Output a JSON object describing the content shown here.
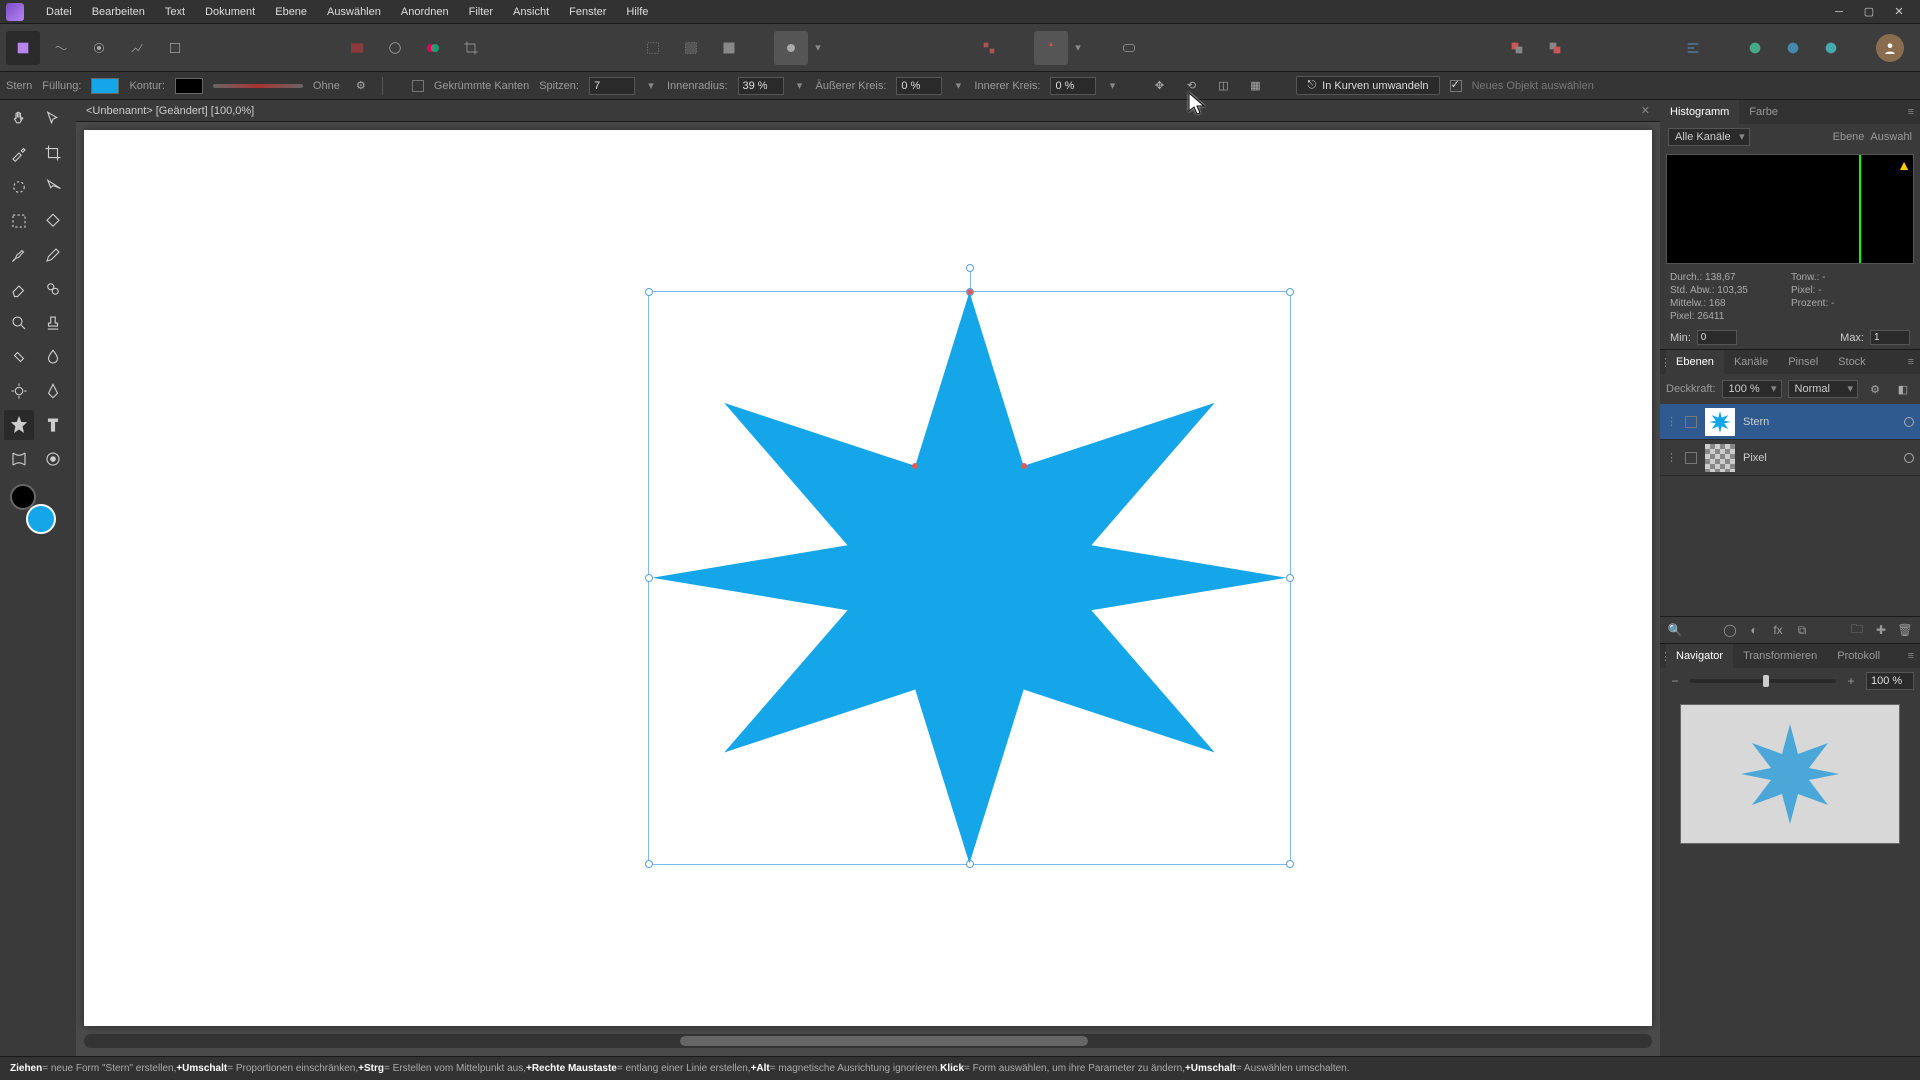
{
  "menu": {
    "items": [
      "Datei",
      "Bearbeiten",
      "Text",
      "Dokument",
      "Ebene",
      "Auswählen",
      "Anordnen",
      "Filter",
      "Ansicht",
      "Fenster",
      "Hilfe"
    ]
  },
  "doc": {
    "title": "<Unbenannt>",
    "modified": "[Geändert]",
    "zoom": "[100,0%]"
  },
  "context": {
    "tool_name": "Stern",
    "fill_label": "Füllung:",
    "stroke_label": "Kontur:",
    "stroke_style": "Ohne",
    "curved_label": "Gekrümmte Kanten",
    "points_label": "Spitzen:",
    "points_value": "7",
    "inner_radius_label": "Innenradius:",
    "inner_radius_value": "39 %",
    "outer_circle_label": "Äußerer Kreis:",
    "outer_circle_value": "0 %",
    "inner_circle_label": "Innerer Kreis:",
    "inner_circle_value": "0 %",
    "convert_label": "In Kurven umwandeln",
    "new_obj_label": "Neues Objekt auswählen"
  },
  "colors": {
    "fill": "#14a6e8",
    "stroke": "#000000"
  },
  "histogram": {
    "tab1": "Histogramm",
    "tab2": "Farbe",
    "channels": "Alle Kanäle",
    "ebene": "Ebene",
    "auswahl": "Auswahl",
    "durch_label": "Durch.:",
    "durch": "138,67",
    "std_label": "Std. Abw.:",
    "std": "103,35",
    "mittelw_label": "Mittelw.:",
    "mittelw": "168",
    "pixel_label": "Pixel:",
    "pixel": "26411",
    "tonw_label": "Tonw.:",
    "tonw": "-",
    "pixel2_label": "Pixel:",
    "pixel2": "-",
    "prozent_label": "Prozent:",
    "prozent": "-",
    "min_label": "Min:",
    "min": "0",
    "max_label": "Max:",
    "max": "1"
  },
  "layers_panel": {
    "tabs": [
      "Ebenen",
      "Kanäle",
      "Pinsel",
      "Stock"
    ],
    "opacity_label": "Deckkraft:",
    "opacity": "100 %",
    "blend": "Normal",
    "layers": [
      {
        "name": "Stern",
        "selected": true
      },
      {
        "name": "Pixel",
        "selected": false
      }
    ]
  },
  "navigator": {
    "tabs": [
      "Navigator",
      "Transformieren",
      "Protokoll"
    ],
    "zoom": "100 %"
  },
  "status": {
    "t1": "Ziehen",
    "s1": " = neue Form \"Stern\" erstellen, ",
    "t2": "+Umschalt",
    "s2": " = Proportionen einschränken, ",
    "t3": "+Strg",
    "s3": " = Erstellen vom Mittelpunkt aus, ",
    "t4": "+Rechte Maustaste",
    "s4": " = entlang einer Linie erstellen, ",
    "t5": "+Alt",
    "s5": " = magnetische Ausrichtung ignorieren. ",
    "t6": "Klick",
    "s6": " = Form auswählen, um ihre Parameter zu ändern, ",
    "t7": "+Umschalt",
    "s7": " = Auswählen umschalten."
  }
}
